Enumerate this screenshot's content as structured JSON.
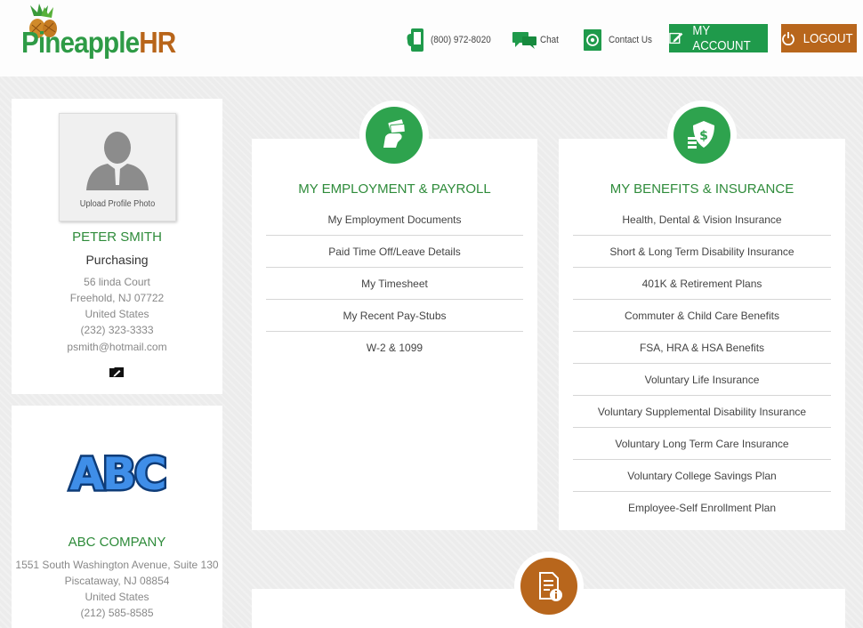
{
  "brand": {
    "part1": "Pineapple",
    "part2": "HR"
  },
  "header": {
    "phone": "(800) 972-8020",
    "chat": "Chat",
    "contact": "Contact Us",
    "account": "MY ACCOUNT",
    "logout": "LOGOUT"
  },
  "profile": {
    "photo_caption": "Upload Profile Photo",
    "name": "PETER SMITH",
    "department": "Purchasing",
    "address1": "56 linda Court",
    "address2": "Freehold, NJ 07722",
    "country": "United States",
    "phone": "(232) 323-3333",
    "email": "psmith@hotmail.com"
  },
  "company": {
    "logo_text": "ABC",
    "name": "ABC COMPANY",
    "address1": "1551 South Washington Avenue, Suite 130",
    "address2": "Piscataway, NJ 08854",
    "country": "United States",
    "phone": "(212) 585-8585"
  },
  "employment": {
    "title": "MY EMPLOYMENT & PAYROLL",
    "items": [
      "My Employment Documents",
      "Paid Time Off/Leave Details",
      "My Timesheet",
      "My Recent Pay-Stubs",
      "W-2 & 1099"
    ]
  },
  "benefits": {
    "title": "MY BENEFITS & INSURANCE",
    "items": [
      "Health, Dental & Vision Insurance",
      "Short & Long Term Disability Insurance",
      "401K & Retirement Plans",
      "Commuter & Child Care Benefits",
      "FSA, HRA & HSA Benefits",
      "Voluntary Life Insurance",
      "Voluntary Supplemental Disability Insurance",
      "Voluntary Long Term Care Insurance",
      "Voluntary College Savings Plan",
      "Employee-Self Enrollment Plan"
    ]
  },
  "colors": {
    "green": "#2e8b3a",
    "button_green": "#1f9a4b",
    "orange": "#b8661c"
  }
}
